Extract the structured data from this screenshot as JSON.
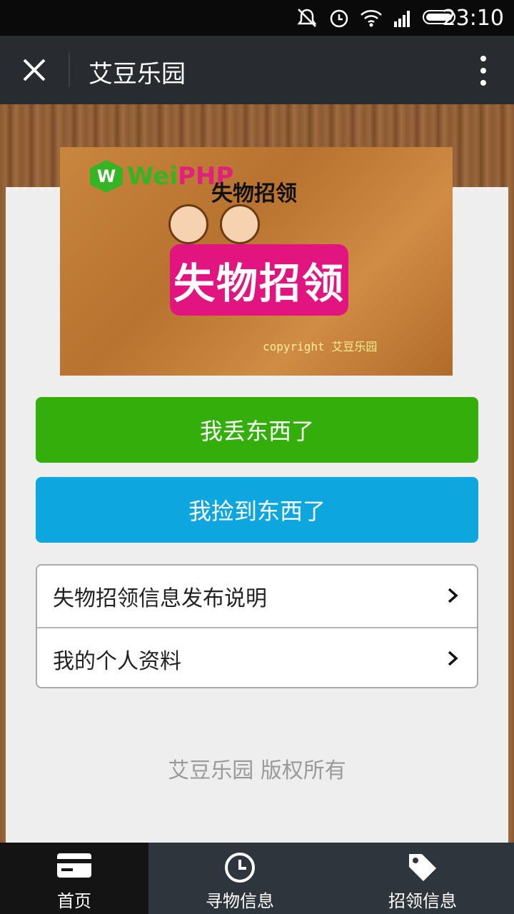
{
  "status_bar": {
    "time": "23:10",
    "icons": [
      "mute-icon",
      "alarm-icon",
      "wifi-icon",
      "signal-icon",
      "battery-icon"
    ]
  },
  "navbar": {
    "title": "艾豆乐园",
    "close_icon": "close-icon",
    "more_icon": "more-vertical-icon"
  },
  "banner": {
    "logo_letter": "W",
    "logo_wei": "Wei",
    "logo_php": "PHP",
    "overlay_title": "失物招领",
    "sign_text": "失物招领",
    "copyright": "copyright 艾豆乐园"
  },
  "buttons": {
    "lost": "我丢东西了",
    "found": "我捡到东西了"
  },
  "list": [
    {
      "label": "失物招领信息发布说明"
    },
    {
      "label": "我的个人资料"
    }
  ],
  "footer": {
    "text": "艾豆乐园 版权所有"
  },
  "tabs": [
    {
      "label": "首页",
      "icon": "card-icon"
    },
    {
      "label": "寻物信息",
      "icon": "clock-icon"
    },
    {
      "label": "招领信息",
      "icon": "tag-icon"
    }
  ],
  "colors": {
    "green_button": "#33ae0b",
    "blue_button": "#0ea6df",
    "navbar": "#282c31",
    "tabbar": "#2f353c",
    "pink_sign": "#e2147f"
  }
}
